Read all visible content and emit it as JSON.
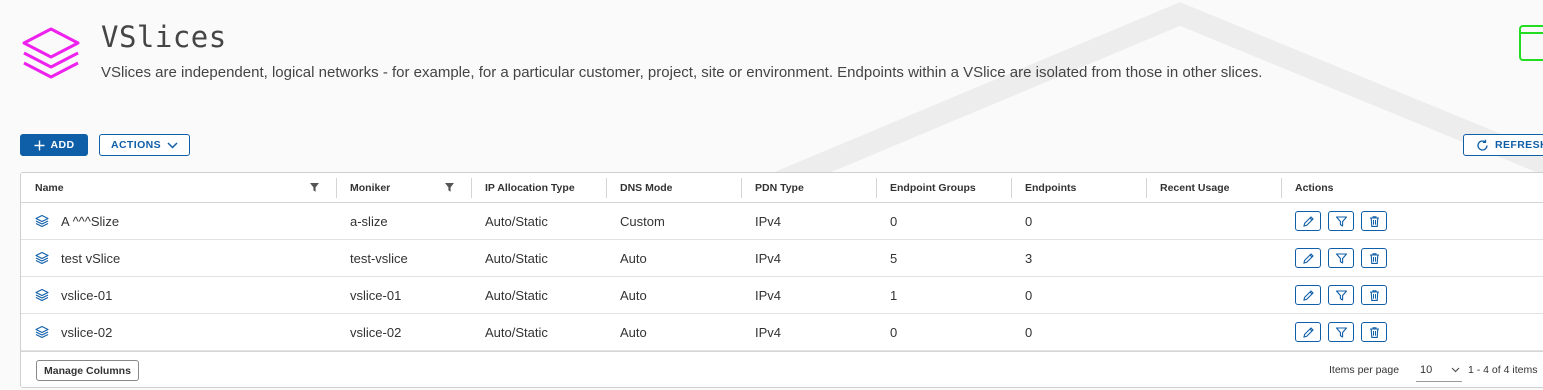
{
  "header": {
    "title": "VSlices",
    "description": "VSlices are independent, logical networks - for example, for a particular customer, project, site or environment. Endpoints within a VSlice are isolated from those in other slices.",
    "icon": "layers-icon",
    "icon_color": "#ee22ee"
  },
  "toolbar": {
    "add_label": "ADD",
    "actions_label": "ACTIONS",
    "refresh_label": "REFRESH"
  },
  "table": {
    "columns": [
      "Name",
      "Moniker",
      "IP Allocation Type",
      "DNS Mode",
      "PDN Type",
      "Endpoint Groups",
      "Endpoints",
      "Recent Usage",
      "Actions"
    ],
    "rows": [
      {
        "name": "A ^^^Slize",
        "moniker": "a-slize",
        "ip_allocation": "Auto/Static",
        "dns_mode": "Custom",
        "pdn_type": "IPv4",
        "endpoint_groups": "0",
        "endpoints": "0",
        "recent_usage": ""
      },
      {
        "name": "test vSlice",
        "moniker": "test-vslice",
        "ip_allocation": "Auto/Static",
        "dns_mode": "Auto",
        "pdn_type": "IPv4",
        "endpoint_groups": "5",
        "endpoints": "3",
        "recent_usage": ""
      },
      {
        "name": "vslice-01",
        "moniker": "vslice-01",
        "ip_allocation": "Auto/Static",
        "dns_mode": "Auto",
        "pdn_type": "IPv4",
        "endpoint_groups": "1",
        "endpoints": "0",
        "recent_usage": ""
      },
      {
        "name": "vslice-02",
        "moniker": "vslice-02",
        "ip_allocation": "Auto/Static",
        "dns_mode": "Auto",
        "pdn_type": "IPv4",
        "endpoint_groups": "0",
        "endpoints": "0",
        "recent_usage": ""
      }
    ]
  },
  "footer": {
    "manage_columns_label": "Manage Columns",
    "items_per_page_label": "Items per page",
    "page_size": "10",
    "range_label": "1 - 4 of 4 items"
  },
  "colors": {
    "accent": "#0f5ea8",
    "brand": "#ee22ee",
    "corner_icon": "#22dd22"
  }
}
